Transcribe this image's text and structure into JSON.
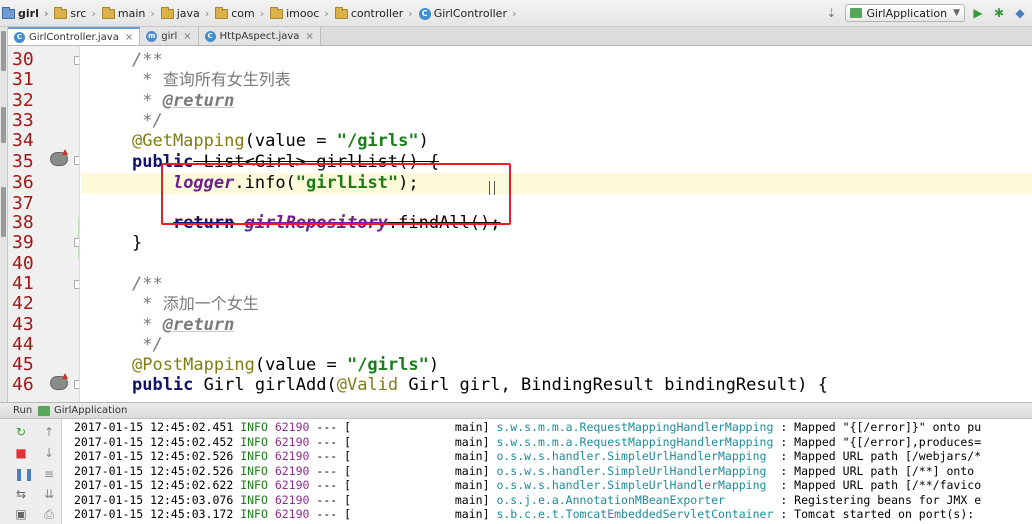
{
  "breadcrumb": [
    {
      "label": "girl",
      "icon": "project-folder-icon",
      "bold": true
    },
    {
      "label": "src",
      "icon": "folder-icon"
    },
    {
      "label": "main",
      "icon": "folder-icon"
    },
    {
      "label": "java",
      "icon": "folder-icon"
    },
    {
      "label": "com",
      "icon": "folder-icon"
    },
    {
      "label": "imooc",
      "icon": "folder-icon"
    },
    {
      "label": "controller",
      "icon": "folder-icon"
    },
    {
      "label": "GirlController",
      "icon": "java-class-icon"
    }
  ],
  "toolbar": {
    "run_config": "GirlApplication"
  },
  "tabs": [
    {
      "label": "GirlController.java",
      "icon_letter": "C",
      "color": "#3f8fd0",
      "active": true
    },
    {
      "label": "girl",
      "icon_letter": "m",
      "color": "#4f8ccf",
      "active": false
    },
    {
      "label": "HttpAspect.java",
      "icon_letter": "C",
      "color": "#3f8fd0",
      "active": false
    }
  ],
  "line_numbers": [
    "30",
    "31",
    "32",
    "33",
    "34",
    "35",
    "36",
    "37",
    "38",
    "39",
    "40",
    "41",
    "42",
    "43",
    "44",
    "45",
    "46"
  ],
  "code": {
    "l30": "/**",
    "l31_star": "* ",
    "l31_text": "查询所有女生列表",
    "l32_star": "* ",
    "l32_tag": "@return",
    "l33": "*/",
    "l34_anno": "@GetMapping",
    "l34_mid": "(value = ",
    "l34_str": "\"/girls\"",
    "l34_end": ")",
    "l35_kw": "public",
    "l35_rest": " List<Girl> girlList() {",
    "l36_field": "logger",
    "l36_mid": ".info(",
    "l36_str": "\"girlList\"",
    "l36_end": ");",
    "l38_kw": "return",
    "l38_field": "girlRepository",
    "l38_rest": ".findAll();",
    "l39": "}",
    "l41": "/**",
    "l42_star": "* ",
    "l42_text": "添加一个女生",
    "l43_star": "* ",
    "l43_tag": "@return",
    "l44": "*/",
    "l45_anno": "@PostMapping",
    "l45_mid": "(value = ",
    "l45_str": "\"/girls\"",
    "l45_end": ")",
    "l46_kw": "public",
    "l46_rest": " Girl girlAdd(",
    "l46_anno": "@Valid",
    "l46_rest2": " Girl girl, BindingResult bindingResult) {"
  },
  "run_panel": {
    "label": "Run",
    "tab": "GirlApplication"
  },
  "console": [
    {
      "ts": "2017-01-15 12:45:02.451",
      "level": "INFO",
      "pid": "62190",
      "sep": "--- [",
      "thread": "main]",
      "logger": "s.w.s.m.m.a.RequestMappingHandlerMapping",
      "msg": ": Mapped \"{[/error]}\" onto pu"
    },
    {
      "ts": "2017-01-15 12:45:02.452",
      "level": "INFO",
      "pid": "62190",
      "sep": "--- [",
      "thread": "main]",
      "logger": "s.w.s.m.m.a.RequestMappingHandlerMapping",
      "msg": ": Mapped \"{[/error],produces="
    },
    {
      "ts": "2017-01-15 12:45:02.526",
      "level": "INFO",
      "pid": "62190",
      "sep": "--- [",
      "thread": "main]",
      "logger": "o.s.w.s.handler.SimpleUrlHandlerMapping ",
      "msg": ": Mapped URL path [/webjars/*"
    },
    {
      "ts": "2017-01-15 12:45:02.526",
      "level": "INFO",
      "pid": "62190",
      "sep": "--- [",
      "thread": "main]",
      "logger": "o.s.w.s.handler.SimpleUrlHandlerMapping ",
      "msg": ": Mapped URL path [/**] onto"
    },
    {
      "ts": "2017-01-15 12:45:02.622",
      "level": "INFO",
      "pid": "62190",
      "sep": "--- [",
      "thread": "main]",
      "logger": "o.s.w.s.handler.SimpleUrlHandlerMapping ",
      "msg": ": Mapped URL path [/**/favico"
    },
    {
      "ts": "2017-01-15 12:45:03.076",
      "level": "INFO",
      "pid": "62190",
      "sep": "--- [",
      "thread": "main]",
      "logger": "o.s.j.e.a.AnnotationMBeanExporter       ",
      "msg": ": Registering beans for JMX e"
    },
    {
      "ts": "2017-01-15 12:45:03.172",
      "level": "INFO",
      "pid": "62190",
      "sep": "--- [",
      "thread": "main]",
      "logger": "s.b.c.e.t.TomcatEmbeddedServletContainer",
      "msg": ": Tomcat started on port(s):"
    }
  ]
}
